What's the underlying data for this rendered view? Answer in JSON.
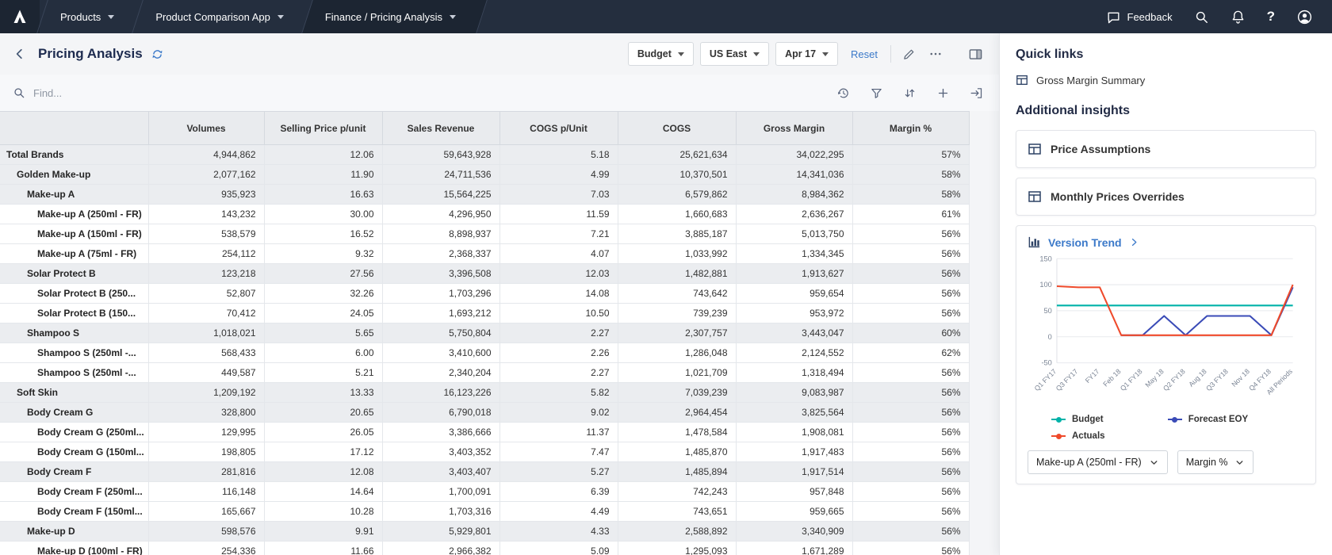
{
  "topbar": {
    "tabs": [
      {
        "label": "Products"
      },
      {
        "label": "Product Comparison App"
      },
      {
        "label": "Finance / Pricing Analysis"
      }
    ],
    "feedback_label": "Feedback"
  },
  "header": {
    "title": "Pricing Analysis",
    "filters": [
      {
        "label": "Budget"
      },
      {
        "label": "US East"
      },
      {
        "label": "Apr 17"
      }
    ],
    "reset_label": "Reset"
  },
  "toolbar": {
    "find_placeholder": "Find..."
  },
  "table": {
    "columns": [
      "Volumes",
      "Selling Price p/unit",
      "Sales Revenue",
      "COGS p/Unit",
      "COGS",
      "Gross Margin",
      "Margin %"
    ],
    "rows": [
      {
        "label": "Total Brands",
        "level": 0,
        "summary": true,
        "values": [
          "4,944,862",
          "12.06",
          "59,643,928",
          "5.18",
          "25,621,634",
          "34,022,295",
          "57%"
        ]
      },
      {
        "label": "Golden Make-up",
        "level": 1,
        "summary": true,
        "values": [
          "2,077,162",
          "11.90",
          "24,711,536",
          "4.99",
          "10,370,501",
          "14,341,036",
          "58%"
        ]
      },
      {
        "label": "Make-up A",
        "level": 2,
        "summary": true,
        "values": [
          "935,923",
          "16.63",
          "15,564,225",
          "7.03",
          "6,579,862",
          "8,984,362",
          "58%"
        ]
      },
      {
        "label": "Make-up A (250ml - FR)",
        "level": 3,
        "summary": false,
        "values": [
          "143,232",
          "30.00",
          "4,296,950",
          "11.59",
          "1,660,683",
          "2,636,267",
          "61%"
        ]
      },
      {
        "label": "Make-up A (150ml - FR)",
        "level": 3,
        "summary": false,
        "values": [
          "538,579",
          "16.52",
          "8,898,937",
          "7.21",
          "3,885,187",
          "5,013,750",
          "56%"
        ]
      },
      {
        "label": "Make-up A (75ml - FR)",
        "level": 3,
        "summary": false,
        "values": [
          "254,112",
          "9.32",
          "2,368,337",
          "4.07",
          "1,033,992",
          "1,334,345",
          "56%"
        ]
      },
      {
        "label": "Solar Protect B",
        "level": 2,
        "summary": true,
        "values": [
          "123,218",
          "27.56",
          "3,396,508",
          "12.03",
          "1,482,881",
          "1,913,627",
          "56%"
        ]
      },
      {
        "label": "Solar Protect B (250...",
        "level": 3,
        "summary": false,
        "values": [
          "52,807",
          "32.26",
          "1,703,296",
          "14.08",
          "743,642",
          "959,654",
          "56%"
        ]
      },
      {
        "label": "Solar Protect B (150...",
        "level": 3,
        "summary": false,
        "values": [
          "70,412",
          "24.05",
          "1,693,212",
          "10.50",
          "739,239",
          "953,972",
          "56%"
        ]
      },
      {
        "label": "Shampoo S",
        "level": 2,
        "summary": true,
        "values": [
          "1,018,021",
          "5.65",
          "5,750,804",
          "2.27",
          "2,307,757",
          "3,443,047",
          "60%"
        ]
      },
      {
        "label": "Shampoo S (250ml -...",
        "level": 3,
        "summary": false,
        "values": [
          "568,433",
          "6.00",
          "3,410,600",
          "2.26",
          "1,286,048",
          "2,124,552",
          "62%"
        ]
      },
      {
        "label": "Shampoo S (250ml -...",
        "level": 3,
        "summary": false,
        "values": [
          "449,587",
          "5.21",
          "2,340,204",
          "2.27",
          "1,021,709",
          "1,318,494",
          "56%"
        ]
      },
      {
        "label": "Soft Skin",
        "level": 1,
        "summary": true,
        "values": [
          "1,209,192",
          "13.33",
          "16,123,226",
          "5.82",
          "7,039,239",
          "9,083,987",
          "56%"
        ]
      },
      {
        "label": "Body Cream G",
        "level": 2,
        "summary": true,
        "values": [
          "328,800",
          "20.65",
          "6,790,018",
          "9.02",
          "2,964,454",
          "3,825,564",
          "56%"
        ]
      },
      {
        "label": "Body Cream G (250ml...",
        "level": 3,
        "summary": false,
        "values": [
          "129,995",
          "26.05",
          "3,386,666",
          "11.37",
          "1,478,584",
          "1,908,081",
          "56%"
        ]
      },
      {
        "label": "Body Cream G (150ml...",
        "level": 3,
        "summary": false,
        "values": [
          "198,805",
          "17.12",
          "3,403,352",
          "7.47",
          "1,485,870",
          "1,917,483",
          "56%"
        ]
      },
      {
        "label": "Body Cream F",
        "level": 2,
        "summary": true,
        "values": [
          "281,816",
          "12.08",
          "3,403,407",
          "5.27",
          "1,485,894",
          "1,917,514",
          "56%"
        ]
      },
      {
        "label": "Body Cream F (250ml...",
        "level": 3,
        "summary": false,
        "values": [
          "116,148",
          "14.64",
          "1,700,091",
          "6.39",
          "742,243",
          "957,848",
          "56%"
        ]
      },
      {
        "label": "Body Cream F (150ml...",
        "level": 3,
        "summary": false,
        "values": [
          "165,667",
          "10.28",
          "1,703,316",
          "4.49",
          "743,651",
          "959,665",
          "56%"
        ]
      },
      {
        "label": "Make-up D",
        "level": 2,
        "summary": true,
        "values": [
          "598,576",
          "9.91",
          "5,929,801",
          "4.33",
          "2,588,892",
          "3,340,909",
          "56%"
        ]
      },
      {
        "label": "Make-up D (100ml - FR)",
        "level": 3,
        "summary": false,
        "values": [
          "254,336",
          "11.66",
          "2,966,382",
          "5.09",
          "1,295,093",
          "1,671,289",
          "56%"
        ]
      }
    ]
  },
  "sidebar": {
    "quick_links_title": "Quick links",
    "quick_links": [
      {
        "label": "Gross Margin Summary"
      }
    ],
    "insights_title": "Additional insights",
    "cards": [
      {
        "label": "Price Assumptions"
      },
      {
        "label": "Monthly Prices Overrides"
      }
    ],
    "version_trend": {
      "title": "Version Trend",
      "selectors": [
        "Make-up A (250ml - FR)",
        "Margin %"
      ]
    }
  },
  "chart_data": {
    "type": "line",
    "title": "Version Trend",
    "x": [
      "Q1 FY17",
      "Q3 FY17",
      "FY17",
      "Feb 18",
      "Q1 FY18",
      "May 18",
      "Q2 FY18",
      "Aug 18",
      "Q3 FY18",
      "Nov 18",
      "Q4 FY18",
      "All Periods"
    ],
    "ylim": [
      -50,
      150
    ],
    "yticks": [
      150,
      100,
      50,
      0,
      -50
    ],
    "legend_position": "bottom",
    "series": [
      {
        "name": "Budget",
        "color": "#00b2a9",
        "values": [
          60,
          60,
          60,
          60,
          60,
          60,
          60,
          60,
          60,
          60,
          60,
          60
        ]
      },
      {
        "name": "Forecast EOY",
        "color": "#3a4bb7",
        "values": [
          null,
          null,
          null,
          3,
          3,
          40,
          3,
          40,
          40,
          40,
          3,
          95
        ]
      },
      {
        "name": "Actuals",
        "color": "#ef4a2b",
        "values": [
          97,
          95,
          95,
          3,
          3,
          3,
          3,
          3,
          3,
          3,
          3,
          100
        ]
      }
    ]
  }
}
